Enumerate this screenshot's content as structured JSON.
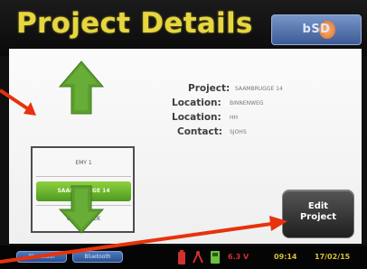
{
  "header": {
    "title": "Project Details",
    "logo_text": "bSD"
  },
  "list": {
    "items": [
      {
        "label": "EMY 1",
        "selected": false
      },
      {
        "label": "SAAMBRUGGE 14",
        "selected": true
      },
      {
        "label": "ONDERTHEK",
        "selected": false
      }
    ]
  },
  "details": {
    "project_label": "Project:",
    "project_value": "SAAMBRUGGE 14",
    "location1_label": "Location:",
    "location1_value": "BINNENWEG",
    "location2_label": "Location:",
    "location2_value": "HH",
    "contact_label": "Contact:",
    "contact_value": "SJOHS"
  },
  "edit_button": {
    "label": "Edit\nProject"
  },
  "statusbar": {
    "button1": "Bluetooth",
    "button2": "Bluetooth",
    "voltage": "6.3 V",
    "time": "09:14",
    "date": "17/02/15"
  },
  "colors": {
    "title": "#e6d640",
    "arrow_green": "#5aa02c",
    "selected_green": "#6cb530",
    "annotation_red": "#e8320c",
    "status_red": "#d03030",
    "status_green": "#6cc040",
    "status_yellow": "#d8c030"
  }
}
